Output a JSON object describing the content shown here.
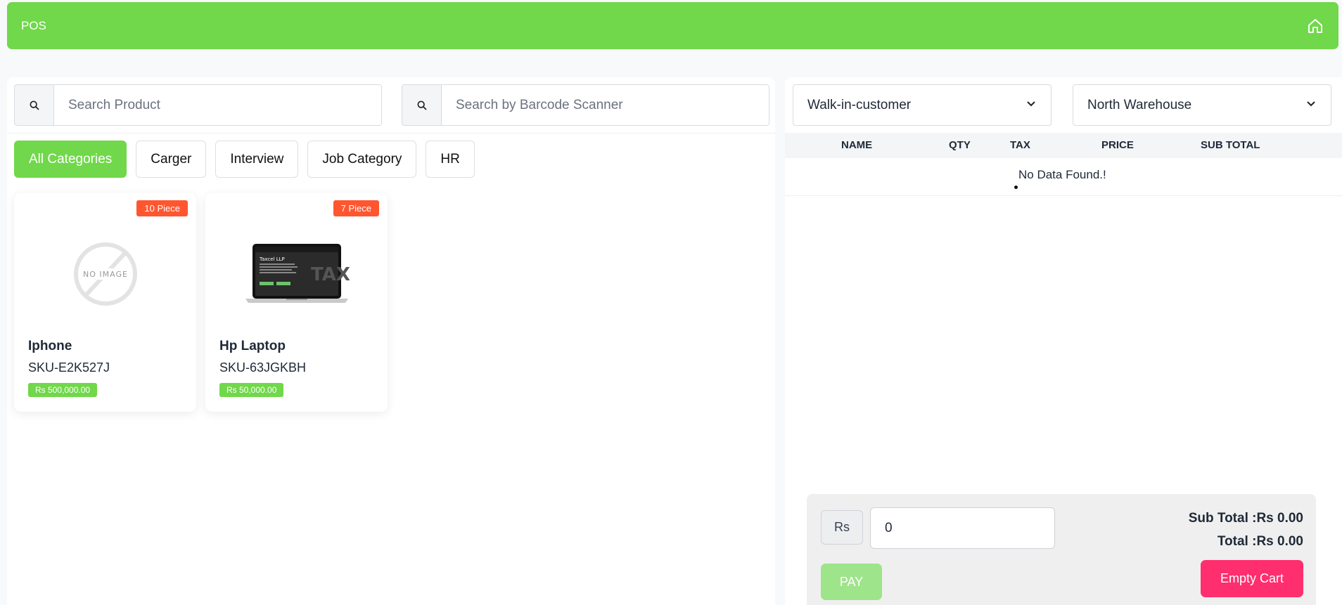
{
  "header": {
    "title": "POS",
    "home_icon": "home-icon"
  },
  "search": {
    "product_placeholder": "Search Product",
    "barcode_placeholder": "Search by Barcode Scanner"
  },
  "categories": [
    "All Categories",
    "Carger",
    "Interview",
    "Job Category",
    "HR"
  ],
  "products": [
    {
      "stock": "10 Piece",
      "name": "Iphone",
      "sku": "SKU-E2K527J",
      "price": "Rs 500,000.00",
      "image": "NO IMAGE"
    },
    {
      "stock": "7 Piece",
      "name": "Hp Laptop",
      "sku": "SKU-63JGKBH",
      "price": "Rs 50,000.00",
      "image_screen": "Taxcel LLP"
    }
  ],
  "cart": {
    "customer": "Walk-in-customer",
    "warehouse": "North Warehouse",
    "columns": [
      "NAME",
      "QTY",
      "TAX",
      "PRICE",
      "SUB TOTAL"
    ],
    "empty_message": "No Data Found.!"
  },
  "footer": {
    "currency": "Rs",
    "amount": "0",
    "subtotal": "Sub Total :Rs 0.00",
    "total": "Total :Rs 0.00",
    "pay_label": "PAY",
    "empty_cart_label": "Empty Cart"
  },
  "colors": {
    "brand": "#70d84a",
    "badge": "#ff5630",
    "danger": "#ff2e6e",
    "pay_disabled": "#9ee48a"
  }
}
